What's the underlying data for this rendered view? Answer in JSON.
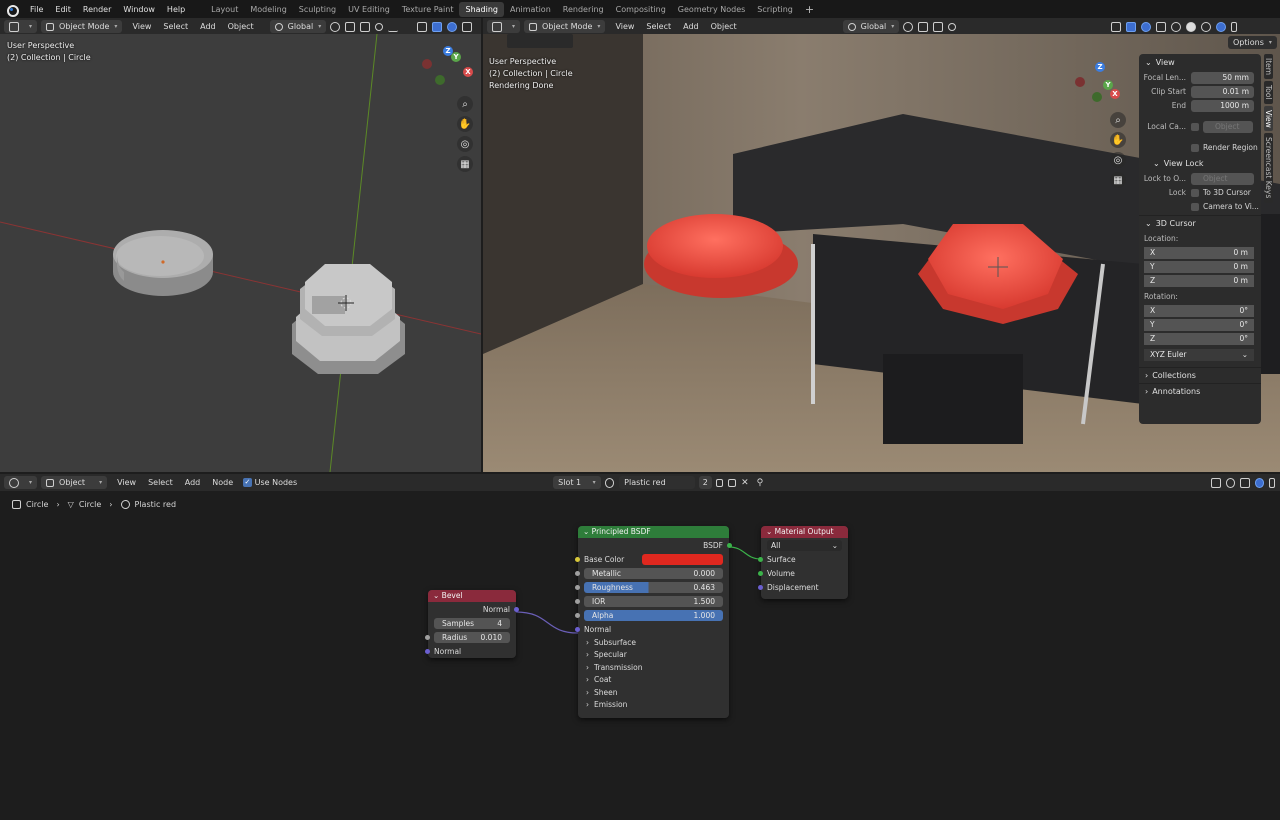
{
  "topbar": {
    "menu": [
      "File",
      "Edit",
      "Render",
      "Window",
      "Help"
    ],
    "workspaces": [
      "Layout",
      "Modeling",
      "Sculpting",
      "UV Editing",
      "Texture Paint",
      "Shading",
      "Animation",
      "Rendering",
      "Compositing",
      "Geometry Nodes",
      "Scripting"
    ],
    "active_workspace": "Shading",
    "add_tab": "+"
  },
  "left_view": {
    "mode": "Object Mode",
    "menu": [
      "View",
      "Select",
      "Add",
      "Object"
    ],
    "orientation": "Global",
    "overlay": [
      "User Perspective",
      "(2) Collection | Circle"
    ],
    "gizmo": {
      "z": "Z",
      "y": "Y",
      "x": "X"
    }
  },
  "right_view": {
    "mode": "Object Mode",
    "menu": [
      "View",
      "Select",
      "Add",
      "Object"
    ],
    "orientation": "Global",
    "options_label": "Options",
    "overlay": [
      "User Perspective",
      "(2) Collection | Circle",
      "Rendering Done"
    ],
    "gizmo": {
      "z": "Z",
      "y": "Y",
      "x": "X"
    }
  },
  "npanel": {
    "view_title": "View",
    "focal_label": "Focal Len...",
    "focal_value": "50 mm",
    "clip_start_label": "Clip Start",
    "clip_start_value": "0.01 m",
    "end_label": "End",
    "end_value": "1000 m",
    "local_cam_label": "Local Ca...",
    "local_cam_placeholder": "Object",
    "render_region": "Render Region",
    "view_lock_title": "View Lock",
    "lock_to_label": "Lock to O...",
    "lock_to_placeholder": "Object",
    "lock_label": "Lock",
    "lock_cursor": "To 3D Cursor",
    "camera_to_view": "Camera to Vi...",
    "cursor_title": "3D Cursor",
    "location_label": "Location:",
    "loc": [
      {
        "axis": "X",
        "value": "0 m"
      },
      {
        "axis": "Y",
        "value": "0 m"
      },
      {
        "axis": "Z",
        "value": "0 m"
      }
    ],
    "rotation_label": "Rotation:",
    "rot": [
      {
        "axis": "X",
        "value": "0°"
      },
      {
        "axis": "Y",
        "value": "0°"
      },
      {
        "axis": "Z",
        "value": "0°"
      }
    ],
    "rotation_mode": "XYZ Euler",
    "collections": "Collections",
    "annotations": "Annotations",
    "tabs": [
      "Item",
      "Tool",
      "View",
      "Screencast Keys"
    ]
  },
  "node_header": {
    "editor_type": "Object",
    "menu": [
      "View",
      "Select",
      "Add",
      "Node"
    ],
    "use_nodes": "Use Nodes",
    "slot": "Slot 1",
    "material": "Plastic red",
    "users": "2"
  },
  "breadcrumb": [
    "Circle",
    "Circle",
    "Plastic red"
  ],
  "nodes": {
    "bevel": {
      "title": "Bevel",
      "output": "Normal",
      "samples_label": "Samples",
      "samples": "4",
      "radius_label": "Radius",
      "radius": "0.010",
      "input": "Normal"
    },
    "bsdf": {
      "title": "Principled BSDF",
      "output": "BSDF",
      "base_color_label": "Base Color",
      "base_color": "#e0281f",
      "metallic_label": "Metallic",
      "metallic": "0.000",
      "roughness_label": "Roughness",
      "roughness": "0.463",
      "ior_label": "IOR",
      "ior": "1.500",
      "alpha_label": "Alpha",
      "alpha": "1.000",
      "normal": "Normal",
      "panels": [
        "Subsurface",
        "Specular",
        "Transmission",
        "Coat",
        "Sheen",
        "Emission"
      ]
    },
    "output": {
      "title": "Material Output",
      "target": "All",
      "surface": "Surface",
      "volume": "Volume",
      "displacement": "Displacement"
    }
  }
}
